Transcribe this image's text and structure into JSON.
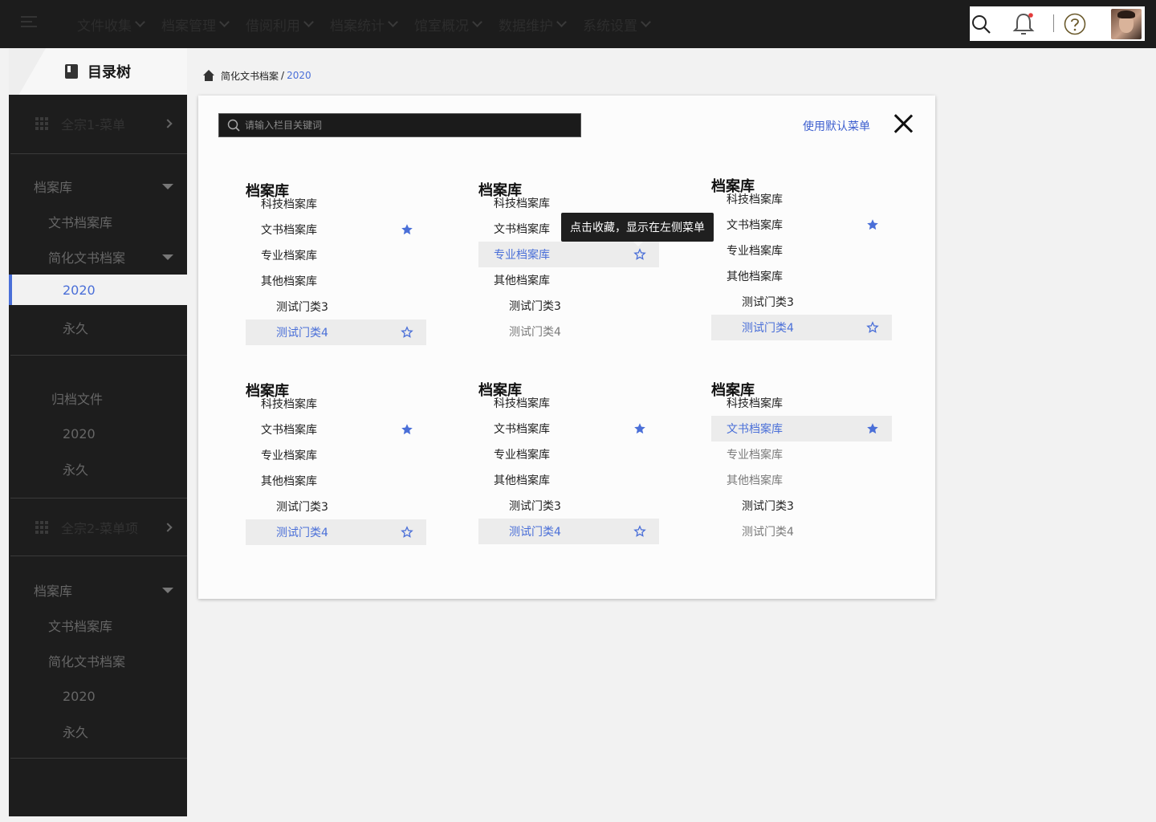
{
  "topbar": {
    "menu_icon": "hamburger-icon",
    "nav": [
      {
        "label": "文件收集"
      },
      {
        "label": "档案管理"
      },
      {
        "label": "借阅利用"
      },
      {
        "label": "档案统计"
      },
      {
        "label": "馆室概况"
      },
      {
        "label": "数据维护"
      },
      {
        "label": "系统设置"
      }
    ],
    "tools": {
      "search_icon": "search-icon",
      "bell_icon": "bell-icon",
      "notification_dot_color": "#e33b3b",
      "help_icon": "help-icon",
      "avatar": "user-avatar"
    }
  },
  "sidebar": {
    "title": "目录树",
    "group1": {
      "label": "全宗1-菜单"
    },
    "tree1": {
      "root": "档案库",
      "children": [
        "文书档案库",
        "简化文书档案"
      ],
      "leaves": [
        "2020",
        "永久"
      ]
    },
    "archive": {
      "root": "归档文件",
      "leaves": [
        "2020",
        "永久"
      ]
    },
    "group2": {
      "label": "全宗2-菜单项"
    },
    "tree2": {
      "root": "档案库",
      "children": [
        "文书档案库",
        "简化文书档案"
      ],
      "leaves": [
        "2020",
        "永久"
      ]
    }
  },
  "breadcrumb": {
    "parent": "简化文书档案",
    "separator": "/",
    "current": "2020"
  },
  "panel": {
    "search_placeholder": "请输入栏目关键词",
    "default_menu": "使用默认菜单",
    "tooltip": "点击收藏，显示在左侧菜单",
    "accent_color": "#4a6fd8",
    "columns": [
      {
        "title": "档案库",
        "items": [
          "科技档案库",
          "文书档案库",
          "专业档案库",
          "其他档案库",
          "测试门类3",
          "测试门类4"
        ]
      },
      {
        "title": "档案库",
        "items": [
          "科技档案库",
          "文书档案库",
          "专业档案库",
          "其他档案库",
          "测试门类3",
          "测试门类4"
        ]
      },
      {
        "title": "档案库",
        "items": [
          "科技档案库",
          "文书档案库",
          "专业档案库",
          "其他档案库",
          "测试门类3",
          "测试门类4"
        ]
      },
      {
        "title": "档案库",
        "items": [
          "科技档案库",
          "文书档案库",
          "专业档案库",
          "其他档案库",
          "测试门类3",
          "测试门类4"
        ]
      },
      {
        "title": "档案库",
        "items": [
          "科技档案库",
          "文书档案库",
          "专业档案库",
          "其他档案库",
          "测试门类3",
          "测试门类4"
        ]
      },
      {
        "title": "档案库",
        "items": [
          "科技档案库",
          "文书档案库",
          "专业档案库",
          "其他档案库",
          "测试门类3",
          "测试门类4"
        ]
      }
    ]
  }
}
